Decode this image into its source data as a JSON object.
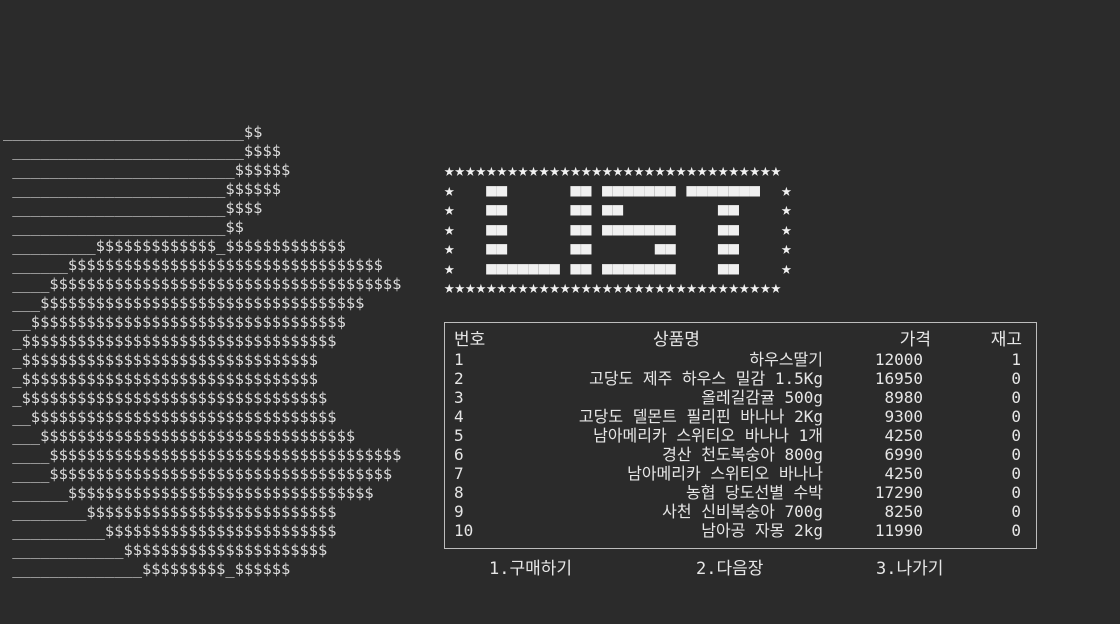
{
  "ascii_art": "__________________________$$\n _________________________$$$$\n ________________________$$$$$$\n _______________________$$$$$$\n _______________________$$$$\n _______________________$$\n _________$$$$$$$$$$$$$_$$$$$$$$$$$$$\n ______$$$$$$$$$$$$$$$$$$$$$$$$$$$$$$$$$$\n ____$$$$$$$$$$$$$$$$$$$$$$$$$$$$$$$$$$$$$$\n ___$$$$$$$$$$$$$$$$$$$$$$$$$$$$$$$$$$$\n __$$$$$$$$$$$$$$$$$$$$$$$$$$$$$$$$$$\n _$$$$$$$$$$$$$$$$$$$$$$$$$$$$$$$$$$\n _$$$$$$$$$$$$$$$$$$$$$$$$$$$$$$$$\n _$$$$$$$$$$$$$$$$$$$$$$$$$$$$$$$$\n _$$$$$$$$$$$$$$$$$$$$$$$$$$$$$$$$$\n __$$$$$$$$$$$$$$$$$$$$$$$$$$$$$$$$$\n ___$$$$$$$$$$$$$$$$$$$$$$$$$$$$$$$$$$\n ____$$$$$$$$$$$$$$$$$$$$$$$$$$$$$$$$$$$$$$\n ____$$$$$$$$$$$$$$$$$$$$$$$$$$$$$$$$$$$$$\n ______$$$$$$$$$$$$$$$$$$$$$$$$$$$$$$$$$\n ________$$$$$$$$$$$$$$$$$$$$$$$$$$$\n __________$$$$$$$$$$$$$$$$$$$$$$$$$\n ____________$$$$$$$$$$$$$$$$$$$$$$\n ______________$$$$$$$$$_$$$$$$",
  "logo": "★★★★★★★★★★★★★★★★★★★★★★★★★★★★★★★★\n★   ■■      ■■ ■■■■■■■ ■■■■■■■  ★\n★   ■■      ■■ ■■         ■■    ★\n★   ■■      ■■ ■■■■■■■    ■■    ★\n★   ■■      ■■      ■■    ■■    ★\n★   ■■■■■■■ ■■ ■■■■■■■    ■■    ★\n★★★★★★★★★★★★★★★★★★★★★★★★★★★★★★★★",
  "table": {
    "headers": {
      "no": "번호",
      "name": "상품명",
      "price": "가격",
      "stock": "재고"
    },
    "rows": [
      {
        "no": "1",
        "name": "하우스딸기",
        "price": "12000",
        "stock": "1"
      },
      {
        "no": "2",
        "name": "고당도 제주 하우스 밀감 1.5Kg",
        "price": "16950",
        "stock": "0"
      },
      {
        "no": "3",
        "name": "올레길감귤 500g",
        "price": "8980",
        "stock": "0"
      },
      {
        "no": "4",
        "name": "고당도 델몬트 필리핀 바나나 2Kg",
        "price": "9300",
        "stock": "0"
      },
      {
        "no": "5",
        "name": "남아메리카 스위티오 바나나 1개",
        "price": "4250",
        "stock": "0"
      },
      {
        "no": "6",
        "name": "경산 천도복숭아 800g",
        "price": "6990",
        "stock": "0"
      },
      {
        "no": "7",
        "name": "남아메리카 스위티오 바나나",
        "price": "4250",
        "stock": "0"
      },
      {
        "no": "8",
        "name": "농협 당도선별 수박",
        "price": "17290",
        "stock": "0"
      },
      {
        "no": "9",
        "name": "사천 신비복숭아 700g",
        "price": "8250",
        "stock": "0"
      },
      {
        "no": "10",
        "name": "남아공 자몽 2kg",
        "price": "11990",
        "stock": "0"
      }
    ]
  },
  "menu": {
    "buy": "1.구매하기",
    "next": "2.다음장",
    "exit": "3.나가기"
  }
}
